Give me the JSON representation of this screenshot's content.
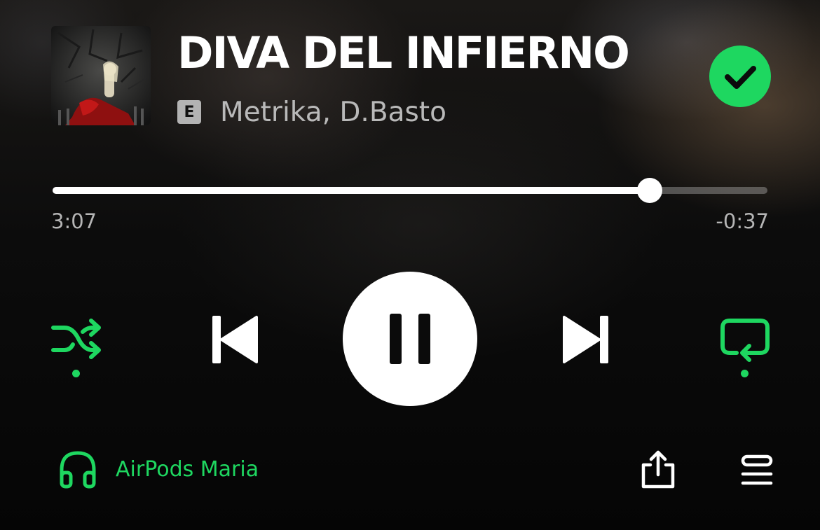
{
  "track": {
    "title": "DIVA DEL INFIERNO",
    "explicit_label": "E",
    "artists": "Metrika, D.Basto",
    "liked": true
  },
  "progress": {
    "elapsed": "3:07",
    "remaining": "-0:37",
    "fraction": 0.835
  },
  "controls": {
    "shuffle_active": true,
    "repeat_active": true,
    "is_playing": true
  },
  "device": {
    "name": "AirPods Maria"
  },
  "colors": {
    "accent_green": "#1ed760",
    "text_primary": "#ffffff",
    "text_secondary": "#b5b5b5"
  },
  "icons": {
    "shuffle": "shuffle-icon",
    "previous": "skip-previous-icon",
    "pause": "pause-icon",
    "next": "skip-next-icon",
    "repeat": "repeat-icon",
    "device": "headphones-icon",
    "share": "share-icon",
    "queue": "queue-icon",
    "liked": "check-icon"
  }
}
